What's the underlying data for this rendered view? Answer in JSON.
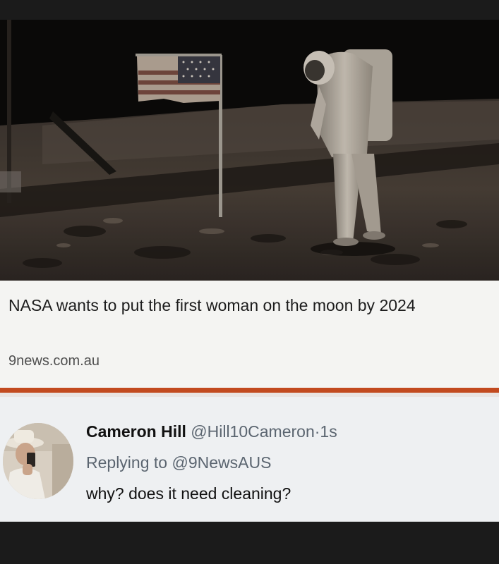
{
  "article": {
    "headline": "NASA wants to put the first woman on the moon by 2024",
    "source": "9news.com.au"
  },
  "tweet": {
    "author_name": "Cameron Hill",
    "handle": "@Hill10Cameron",
    "separator": "·",
    "time": "1s",
    "replying_prefix": "Replying to",
    "replying_to": "@9NewsAUS",
    "text": "why? does it need cleaning?"
  },
  "colors": {
    "divider": "#c24a1f",
    "link_card_bg": "#f4f4f2",
    "tweet_bg": "#eef0f2",
    "frame_bg": "#1b1b1b"
  }
}
